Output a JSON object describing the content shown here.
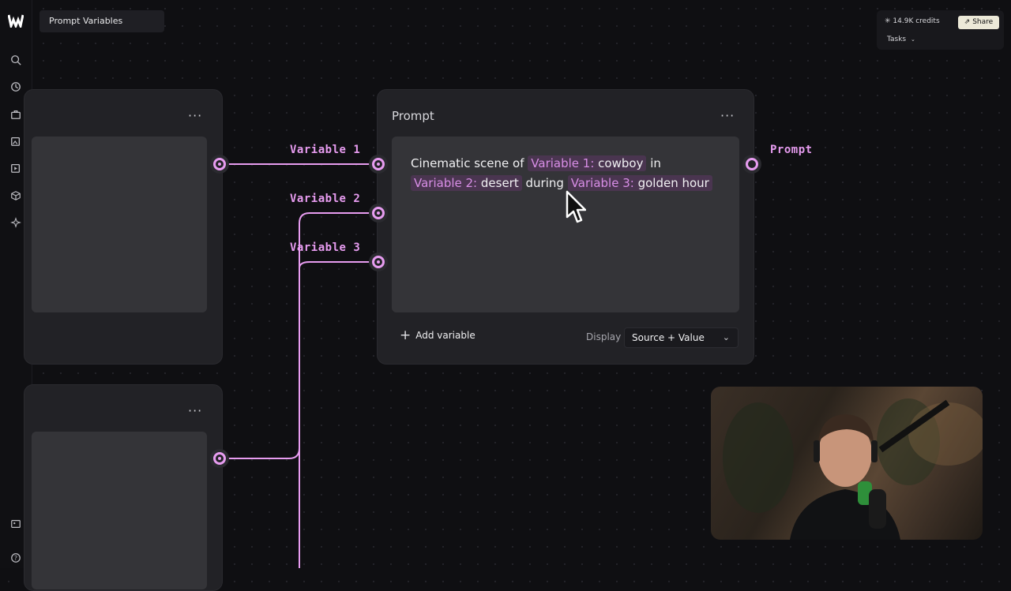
{
  "app": {
    "logo_icon": "weavy-logo-icon",
    "title": "Prompt Variables"
  },
  "sidebar": {
    "icons": [
      "search-icon",
      "history-icon",
      "briefcase-icon",
      "image-edit-icon",
      "video-edit-icon",
      "3d-cube-icon",
      "sparkle-icon",
      "gallery-icon",
      "help-icon"
    ]
  },
  "header": {
    "credits": "14.9K credits",
    "share_label": "Share",
    "tasks_label": "Tasks"
  },
  "wires": {
    "variable1_label": "Variable 1",
    "variable2_label": "Variable 2",
    "variable3_label": "Variable 3",
    "output_label": "Prompt"
  },
  "prompt_node": {
    "title": "Prompt",
    "text_start": "Cinematic scene of",
    "var1_source": "Variable 1:",
    "var1_value": "cowboy",
    "text_in": "in",
    "var2_source": "Variable 2:",
    "var2_value": "desert",
    "text_during": "during",
    "var3_source": "Variable 3:",
    "var3_value": "golden hour",
    "add_variable_label": "Add variable",
    "display_label": "Display",
    "display_value": "Source + Value"
  },
  "colors": {
    "accent": "#e79cf0",
    "background": "#0f0f12",
    "node": "#222226"
  }
}
